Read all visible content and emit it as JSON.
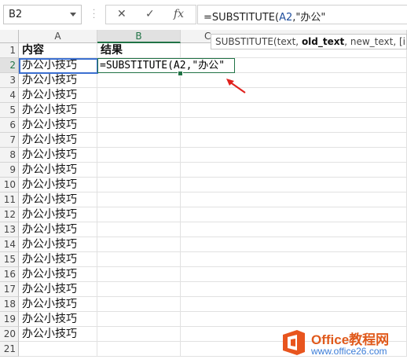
{
  "formula_bar": {
    "name_box": "B2",
    "cancel_icon": "✕",
    "enter_icon": "✓",
    "fx_label": "fx",
    "formula_prefix": "=SUBSTITUTE(",
    "formula_ref": "A2",
    "formula_suffix": ",\"办公\""
  },
  "tooltip": {
    "func": "SUBSTITUTE(text, ",
    "current_arg": "old_text",
    "rest": ", new_text, [insta"
  },
  "columns": [
    "A",
    "B",
    "C"
  ],
  "rows": [
    {
      "num": "1",
      "a": "内容",
      "b": "结果"
    },
    {
      "num": "2",
      "a": "办公小技巧",
      "b": ""
    },
    {
      "num": "3",
      "a": "办公小技巧",
      "b": ""
    },
    {
      "num": "4",
      "a": "办公小技巧",
      "b": ""
    },
    {
      "num": "5",
      "a": "办公小技巧",
      "b": ""
    },
    {
      "num": "6",
      "a": "办公小技巧",
      "b": ""
    },
    {
      "num": "7",
      "a": "办公小技巧",
      "b": ""
    },
    {
      "num": "8",
      "a": "办公小技巧",
      "b": ""
    },
    {
      "num": "9",
      "a": "办公小技巧",
      "b": ""
    },
    {
      "num": "10",
      "a": "办公小技巧",
      "b": ""
    },
    {
      "num": "11",
      "a": "办公小技巧",
      "b": ""
    },
    {
      "num": "12",
      "a": "办公小技巧",
      "b": ""
    },
    {
      "num": "13",
      "a": "办公小技巧",
      "b": ""
    },
    {
      "num": "14",
      "a": "办公小技巧",
      "b": ""
    },
    {
      "num": "15",
      "a": "办公小技巧",
      "b": ""
    },
    {
      "num": "16",
      "a": "办公小技巧",
      "b": ""
    },
    {
      "num": "17",
      "a": "办公小技巧",
      "b": ""
    },
    {
      "num": "18",
      "a": "办公小技巧",
      "b": ""
    },
    {
      "num": "19",
      "a": "办公小技巧",
      "b": ""
    },
    {
      "num": "20",
      "a": "办公小技巧",
      "b": ""
    },
    {
      "num": "21",
      "a": "",
      "b": ""
    }
  ],
  "editing_cell": {
    "text": "=SUBSTITUTE(A2,\"办公\""
  },
  "watermark": {
    "brand": "Office教程网",
    "url": "www.office26.com"
  },
  "colors": {
    "accent": "#217346",
    "arrow": "#e0201c",
    "ref": "#1f4e9c"
  }
}
